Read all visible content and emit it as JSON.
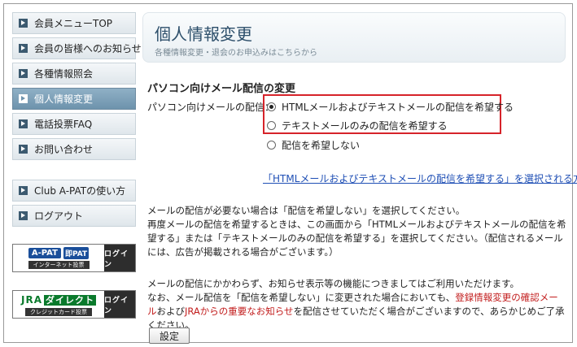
{
  "sidebar": {
    "items": [
      {
        "label": "会員メニューTOP"
      },
      {
        "label": "会員の皆様へのお知らせ"
      },
      {
        "label": "各種情報照会"
      },
      {
        "label": "個人情報変更"
      },
      {
        "label": "電話投票FAQ"
      },
      {
        "label": "お問い合わせ"
      },
      {
        "label": "Club A-PATの使い方"
      },
      {
        "label": "ログアウト"
      }
    ],
    "active_index": 3
  },
  "banners": {
    "apat": {
      "logo_a": "A-PAT",
      "logo_sokuban": "即PAT",
      "sub": "インターネット投票",
      "login": "ログイン"
    },
    "jra": {
      "logo": "JRA",
      "direct": "ダイレクト",
      "sub": "クレジットカード投票",
      "login": "ログイン"
    }
  },
  "header": {
    "title": "個人情報変更",
    "subtitle": "各種情報変更・退会のお申込みはこちらから"
  },
  "section": {
    "title": "パソコン向けメール配信の変更",
    "field_label": "パソコン向けメールの配信：",
    "options": [
      {
        "label": "HTMLメールおよびテキストメールの配信を希望する",
        "checked": true
      },
      {
        "label": "テキストメールのみの配信を希望する",
        "checked": false
      },
      {
        "label": "配信を希望しない",
        "checked": false
      }
    ],
    "link": "「HTMLメールおよびテキストメールの配信を希望する」を選択される方へ"
  },
  "notes": {
    "p1_line1": "メールの配信が必要ない場合は「配信を希望しない」を選択してください。",
    "p1_rest": "再度メールの配信を希望するときは、この画面から「HTMLメールおよびテキストメールの配信を希望する」または「テキストメールのみの配信を希望する」を選択してください。（配信されるメールには、広告が掲載される場合がございます。）",
    "p2_a": "メールの配信にかかわらず、お知らせ表示等の機能につきましてはご利用いただけます。",
    "p2_b": "なお、メール配信を「配信を希望しない」に変更された場合においても、",
    "p2_red1": "登録情報変更の確認メール",
    "p2_c": "および",
    "p2_red2": "JRAからの重要なお知らせ",
    "p2_d": "を配信させていただく場合がございますので、あらかじめご了承ください。"
  },
  "submit_label": "設定",
  "colors": {
    "accent_red": "#d6232a",
    "active_nav": "#7a9db6",
    "link": "#1f4fb5"
  }
}
